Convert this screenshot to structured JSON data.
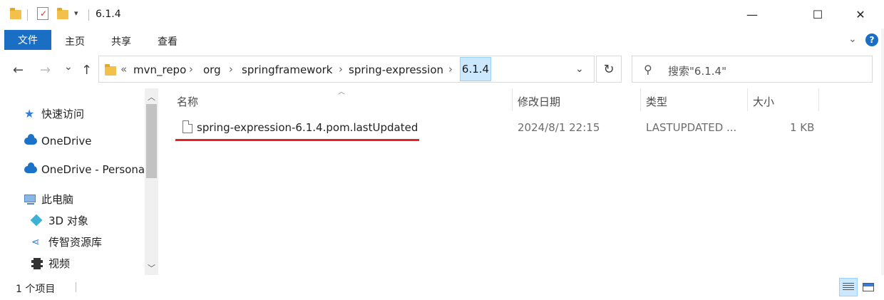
{
  "window": {
    "title": "6.1.4",
    "minimize_glyph": "—",
    "maximize_glyph": "☐",
    "close_glyph": "✕"
  },
  "ribbon": {
    "tabs": [
      "文件",
      "主页",
      "共享",
      "查看"
    ],
    "help": "?",
    "accent_color": "#1a6fc4"
  },
  "nav": {
    "back": "←",
    "forward": "→",
    "recent": "⌄",
    "up": "↑",
    "overflow": "«",
    "breadcrumbs": [
      "mvn_repo",
      "org",
      "springframework",
      "spring-expression"
    ],
    "current": "6.1.4",
    "separator": "›",
    "dropdown": "⌄",
    "refresh": "↻",
    "search_placeholder": "搜索\"6.1.4\""
  },
  "sidebar": {
    "items": [
      {
        "label": "快速访问",
        "icon": "star-icon"
      },
      {
        "label": "OneDrive",
        "icon": "cloud-icon"
      },
      {
        "label": "OneDrive - Personal",
        "icon": "cloud-icon"
      },
      {
        "label": "此电脑",
        "icon": "pc-icon"
      },
      {
        "label": "3D 对象",
        "icon": "cube-icon"
      },
      {
        "label": "传智资源库",
        "icon": "share-icon"
      },
      {
        "label": "视频",
        "icon": "film-icon"
      }
    ]
  },
  "file_list": {
    "columns": [
      "名称",
      "修改日期",
      "类型",
      "大小"
    ],
    "rows": [
      {
        "name": "spring-expression-6.1.4.pom.lastUpdated",
        "modified": "2024/8/1 22:15",
        "type": "LASTUPDATED ...",
        "size": "1 KB"
      }
    ],
    "highlight_color": "#e8202a"
  },
  "status": {
    "item_count": "1 个项目"
  }
}
